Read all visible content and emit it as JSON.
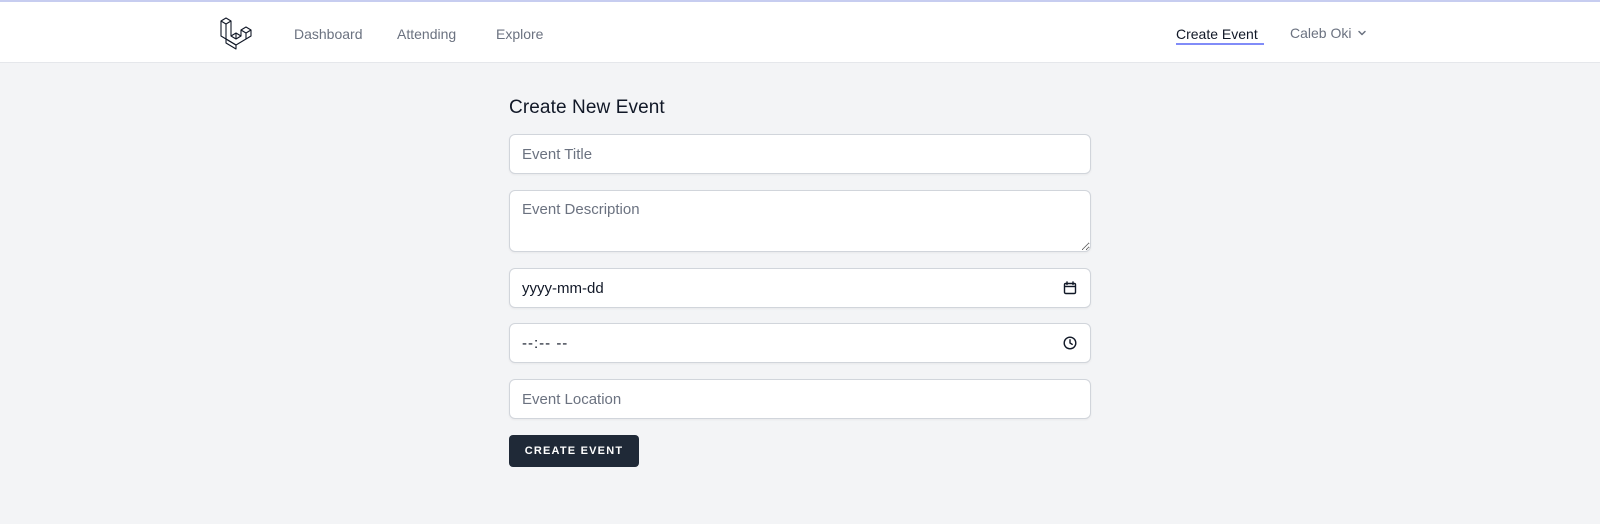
{
  "nav": {
    "logo_icon": "laravel-logo-icon",
    "links": [
      {
        "label": "Dashboard"
      },
      {
        "label": "Attending"
      },
      {
        "label": "Explore"
      }
    ],
    "active_link": "Create Event",
    "user_name": "Caleb Oki",
    "user_menu_icon": "chevron-down-icon",
    "active_underline_color": "#818cf8"
  },
  "form": {
    "title": "Create New Event",
    "title_placeholder": "Event Title",
    "description_placeholder": "Event Description",
    "date_placeholder": "yyyy-mm-dd",
    "date_icon": "calendar-icon",
    "time_placeholder": "--:-- --",
    "time_icon": "clock-icon",
    "location_placeholder": "Event Location",
    "submit_label": "Create Event",
    "submit_color": "#1f2937"
  }
}
